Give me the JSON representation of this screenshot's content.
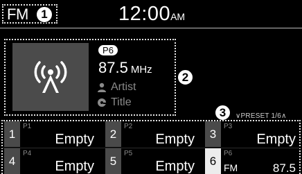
{
  "header": {
    "band": "FM",
    "time": "12:00",
    "ampm": "AM"
  },
  "callouts": [
    "1",
    "2",
    "3"
  ],
  "now_playing": {
    "preset_badge": "P6",
    "frequency": "87.5",
    "unit": "MHz",
    "artist": "Artist",
    "title": "Title",
    "art_icon": "radio-broadcast-icon"
  },
  "preset_nav": {
    "up_chevron": "∨",
    "label": "PRESET",
    "page": "1/6",
    "down_chevron": "∧"
  },
  "presets": [
    {
      "num": "1",
      "slot": "P1",
      "name": "Empty"
    },
    {
      "num": "2",
      "slot": "P2",
      "name": "Empty"
    },
    {
      "num": "3",
      "slot": "P3",
      "name": "Empty"
    },
    {
      "num": "4",
      "slot": "P4",
      "name": "Empty"
    },
    {
      "num": "5",
      "slot": "P5",
      "name": "Empty"
    },
    {
      "num": "6",
      "slot": "P6",
      "band": "FM",
      "value": "87.5"
    }
  ],
  "colors": {
    "background": "#000000",
    "text": "#ffffff",
    "muted_text": "#8a8a8a",
    "tile": "#4a4a4a",
    "selected_tile": "#ececec"
  }
}
